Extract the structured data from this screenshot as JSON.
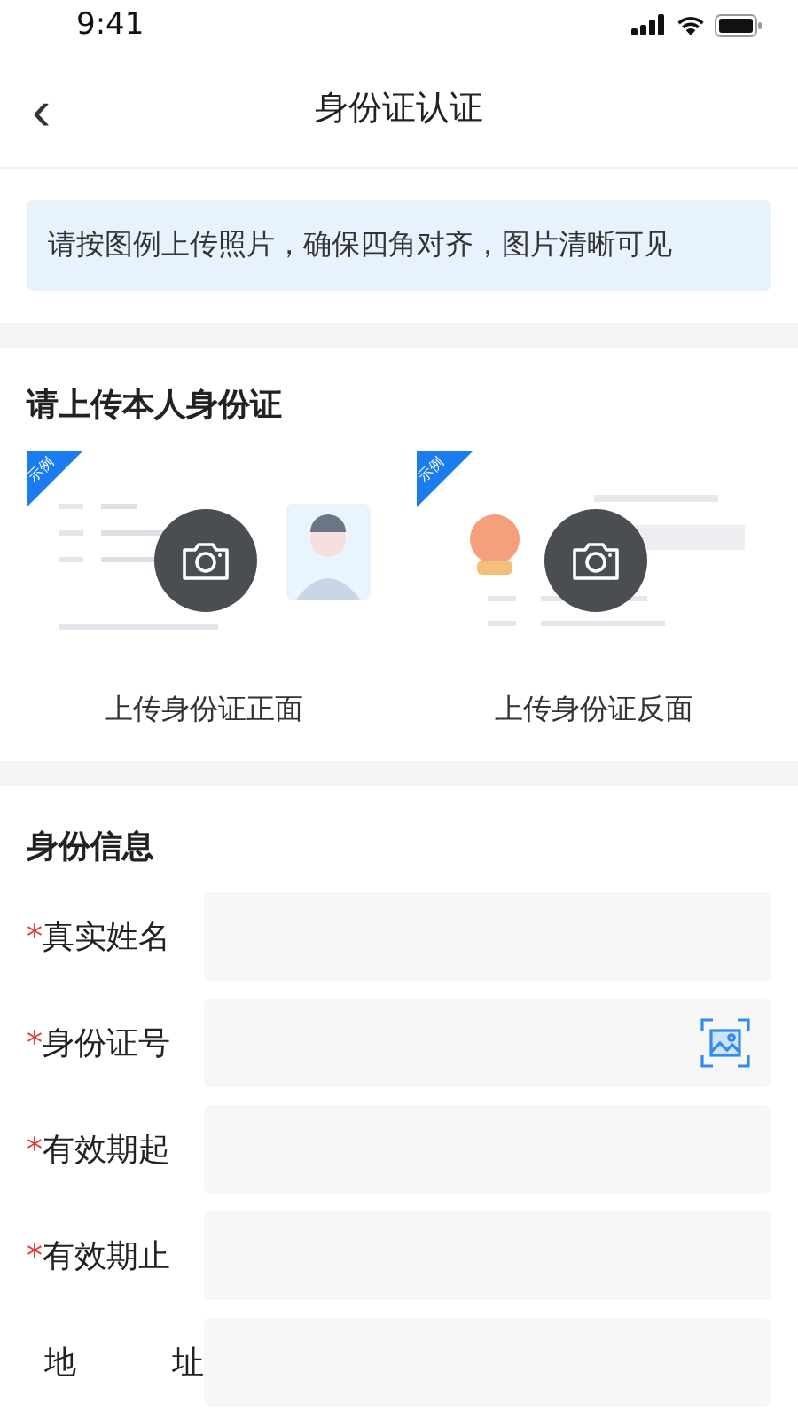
{
  "status_bar": {
    "time": "9:41"
  },
  "nav": {
    "back": "‹",
    "title": "身份证认证"
  },
  "notice": "请按图例上传照片，确保四角对齐，图片清晰可见",
  "upload": {
    "title": "请上传本人身份证",
    "cards": [
      {
        "kind": "front",
        "badge": "示例",
        "label": "上传身份证正面"
      },
      {
        "kind": "back",
        "badge": "示例",
        "label": "上传身份证反面"
      }
    ]
  },
  "info": {
    "title": "身份信息",
    "fields": [
      {
        "kind": "text",
        "mark": "*",
        "label": "真实姓名"
      },
      {
        "kind": "scan",
        "mark": "*",
        "label": "身份证号"
      },
      {
        "kind": "text",
        "mark": "*",
        "label": "有效期起"
      },
      {
        "kind": "text",
        "mark": "*",
        "label": "有效期止"
      },
      {
        "kind": "text",
        "label": "地址"
      }
    ]
  }
}
